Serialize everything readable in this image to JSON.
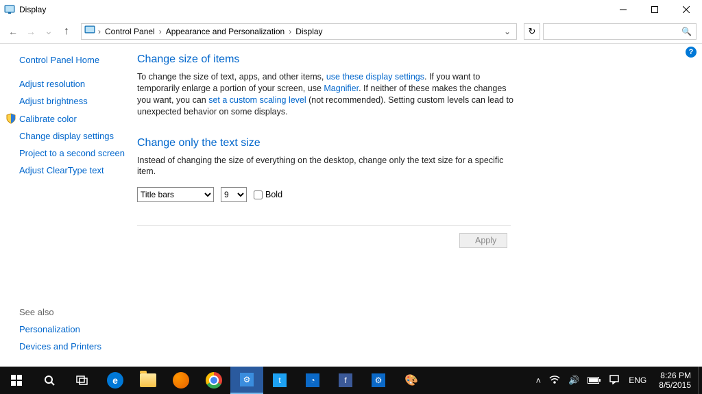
{
  "window": {
    "title": "Display"
  },
  "breadcrumb": {
    "items": [
      "Control Panel",
      "Appearance and Personalization",
      "Display"
    ]
  },
  "sidebar": {
    "home": "Control Panel Home",
    "links": [
      "Adjust resolution",
      "Adjust brightness",
      "Calibrate color",
      "Change display settings",
      "Project to a second screen",
      "Adjust ClearType text"
    ],
    "see_also_hdr": "See also",
    "see_also": [
      "Personalization",
      "Devices and Printers"
    ]
  },
  "main": {
    "h1": "Change size of items",
    "p1_a": "To change the size of text, apps, and other items, ",
    "p1_link1": "use these display settings",
    "p1_b": ".  If you want to temporarily enlarge a portion of your screen, use ",
    "p1_link2": "Magnifier",
    "p1_c": ".  If neither of these makes the changes you want, you can ",
    "p1_link3": "set a custom scaling level",
    "p1_d": " (not recommended).  Setting custom levels can lead to unexpected behavior on some displays.",
    "h2": "Change only the text size",
    "p2": "Instead of changing the size of everything on the desktop, change only the text size for a specific item.",
    "item_select": "Title bars",
    "size_select": "9",
    "bold_label": "Bold",
    "apply": "Apply"
  },
  "taskbar": {
    "lang": "ENG",
    "time": "8:26 PM",
    "date": "8/5/2015"
  }
}
